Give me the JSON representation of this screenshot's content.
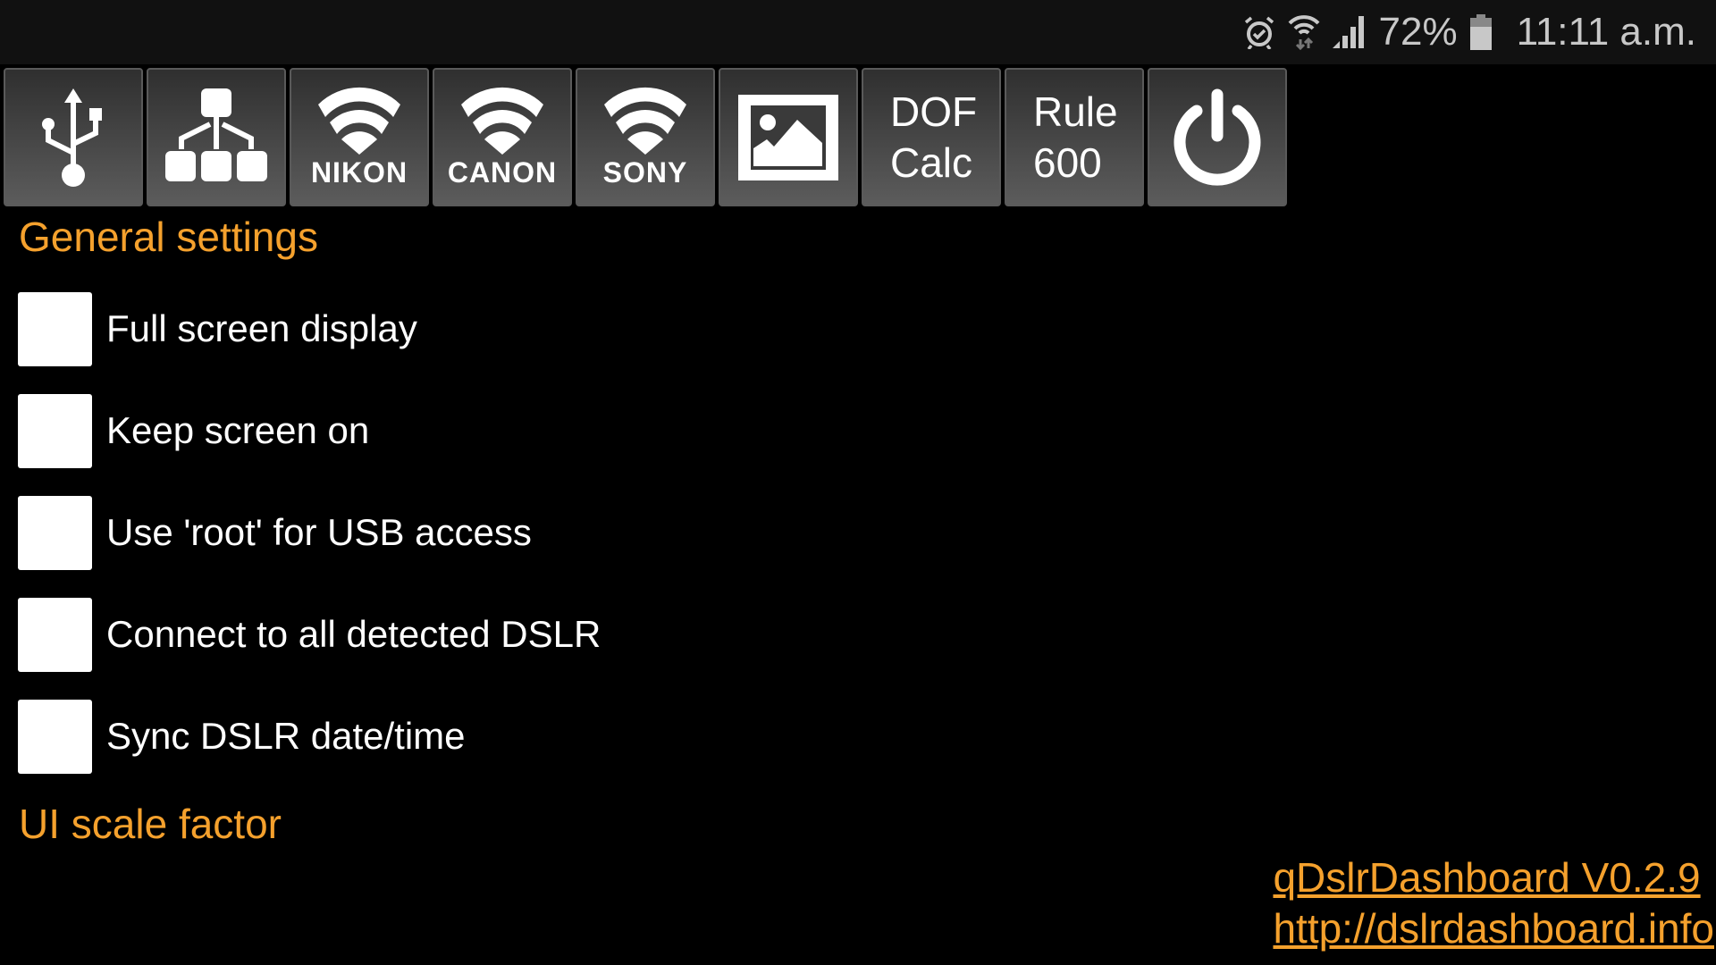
{
  "status_bar": {
    "icons": [
      "alarm-icon",
      "wifi-icon",
      "signal-icon"
    ],
    "battery_percent": "72%",
    "battery_level": 0.72,
    "time": "11:11 a.m."
  },
  "toolbar": {
    "buttons": [
      {
        "id": "usb",
        "icon": "usb-icon"
      },
      {
        "id": "network",
        "icon": "network-icon"
      },
      {
        "id": "nikon",
        "icon": "wifi-icon",
        "label": "NIKON"
      },
      {
        "id": "canon",
        "icon": "wifi-icon",
        "label": "CANON"
      },
      {
        "id": "sony",
        "icon": "wifi-icon",
        "label": "SONY"
      },
      {
        "id": "gallery",
        "icon": "image-icon"
      },
      {
        "id": "dof",
        "line1": "DOF",
        "line2": "Calc"
      },
      {
        "id": "rule600",
        "line1": "Rule",
        "line2": "600"
      },
      {
        "id": "power",
        "icon": "power-icon"
      }
    ]
  },
  "general_settings": {
    "title": "General settings",
    "options": [
      {
        "label": "Full screen display",
        "checked": false
      },
      {
        "label": "Keep screen on",
        "checked": false
      },
      {
        "label": "Use 'root' for USB access",
        "checked": false
      },
      {
        "label": "Connect to all detected DSLR",
        "checked": false
      },
      {
        "label": "Sync DSLR date/time",
        "checked": false
      }
    ]
  },
  "ui_scale": {
    "title": "UI scale factor"
  },
  "footer": {
    "version_link": "qDslrDashboard V0.2.9",
    "website_link": "http://dslrdashboard.info"
  },
  "colors": {
    "accent": "#f5a12d",
    "background": "#000000",
    "statusbar": "#111111"
  }
}
